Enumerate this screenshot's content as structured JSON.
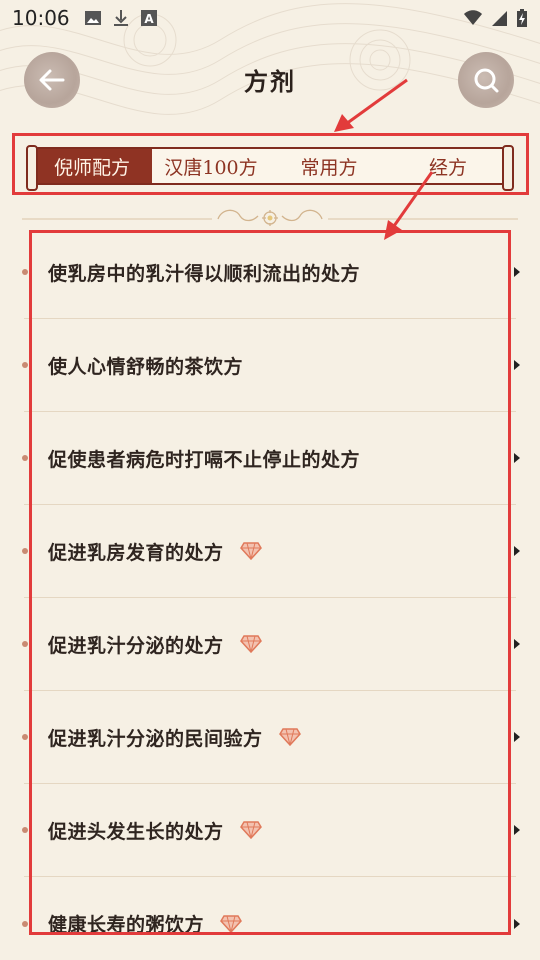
{
  "status_bar": {
    "time": "10:06",
    "left_icons": [
      "image-icon",
      "download-icon",
      "font-icon"
    ],
    "right_icons": [
      "wifi-icon",
      "signal-icon",
      "battery-charging-icon"
    ]
  },
  "header": {
    "title": "方剂",
    "back_icon": "arrow-left-icon",
    "search_icon": "search-icon"
  },
  "tabs": [
    {
      "label": "倪师配方",
      "active": true
    },
    {
      "label": "汉唐100方",
      "active": false
    },
    {
      "label": "常用方",
      "active": false
    },
    {
      "label": "经方",
      "active": false
    }
  ],
  "list": [
    {
      "label": "使乳房中的乳汁得以顺利流出的处方",
      "vip": false
    },
    {
      "label": "使人心情舒畅的茶饮方",
      "vip": false
    },
    {
      "label": "促使患者病危时打嗝不止停止的处方",
      "vip": false
    },
    {
      "label": "促进乳房发育的处方",
      "vip": true
    },
    {
      "label": "促进乳汁分泌的处方",
      "vip": true
    },
    {
      "label": "促进乳汁分泌的民间验方",
      "vip": true
    },
    {
      "label": "促进头发生长的处方",
      "vip": true
    },
    {
      "label": "健康长寿的粥饮方",
      "vip": true
    }
  ],
  "colors": {
    "accent": "#8f3323",
    "annotation": "#e23b3b",
    "background": "#f6f0e4",
    "vip": "#e0795a"
  }
}
